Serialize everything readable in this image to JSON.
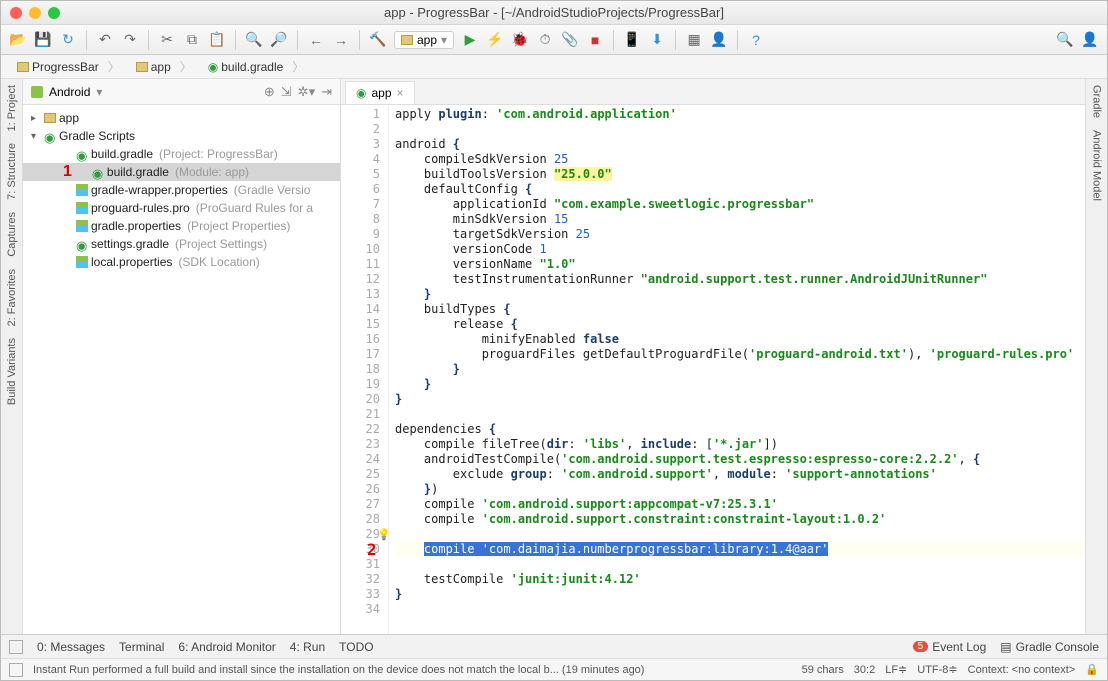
{
  "window": {
    "title": "app - ProgressBar - [~/AndroidStudioProjects/ProgressBar]"
  },
  "run_config": "app",
  "breadcrumb": [
    "ProgressBar",
    "app",
    "build.gradle"
  ],
  "left_tools": [
    "1: Project",
    "7: Structure",
    "Captures",
    "2: Favorites",
    "Build Variants"
  ],
  "right_tools": [
    "Gradle",
    "Android Model"
  ],
  "project_pane": {
    "view": "Android",
    "root": "app",
    "scripts_label": "Gradle Scripts",
    "items": [
      {
        "name": "build.gradle",
        "hint": "(Project: ProgressBar)",
        "icon": "gradle"
      },
      {
        "name": "build.gradle",
        "hint": "(Module: app)",
        "icon": "gradle",
        "selected": true,
        "annot": "1"
      },
      {
        "name": "gradle-wrapper.properties",
        "hint": "(Gradle Versio",
        "icon": "prop"
      },
      {
        "name": "proguard-rules.pro",
        "hint": "(ProGuard Rules for a",
        "icon": "prop"
      },
      {
        "name": "gradle.properties",
        "hint": "(Project Properties)",
        "icon": "prop"
      },
      {
        "name": "settings.gradle",
        "hint": "(Project Settings)",
        "icon": "gradle"
      },
      {
        "name": "local.properties",
        "hint": "(SDK Location)",
        "icon": "prop"
      }
    ]
  },
  "editor_tab": "app",
  "annotation2": "2",
  "code_lines": [
    {
      "n": 1,
      "frags": [
        [
          "p",
          "apply "
        ],
        [
          "kw",
          "plugin"
        ],
        [
          "p",
          ": "
        ],
        [
          "str",
          "'com.android.application'"
        ]
      ]
    },
    {
      "n": 2,
      "frags": []
    },
    {
      "n": 3,
      "frags": [
        [
          "p",
          "android "
        ],
        [
          "kw",
          "{"
        ]
      ]
    },
    {
      "n": 4,
      "frags": [
        [
          "p",
          "    compileSdkVersion "
        ],
        [
          "num",
          "25"
        ]
      ]
    },
    {
      "n": 5,
      "frags": [
        [
          "p",
          "    buildToolsVersion "
        ],
        [
          "str hl-y",
          "\"25.0.0\""
        ]
      ]
    },
    {
      "n": 6,
      "frags": [
        [
          "p",
          "    defaultConfig "
        ],
        [
          "kw",
          "{"
        ]
      ]
    },
    {
      "n": 7,
      "frags": [
        [
          "p",
          "        applicationId "
        ],
        [
          "str",
          "\"com.example.sweetlogic.progressbar\""
        ]
      ]
    },
    {
      "n": 8,
      "frags": [
        [
          "p",
          "        minSdkVersion "
        ],
        [
          "num",
          "15"
        ]
      ]
    },
    {
      "n": 9,
      "frags": [
        [
          "p",
          "        targetSdkVersion "
        ],
        [
          "num",
          "25"
        ]
      ]
    },
    {
      "n": 10,
      "frags": [
        [
          "p",
          "        versionCode "
        ],
        [
          "num",
          "1"
        ]
      ]
    },
    {
      "n": 11,
      "frags": [
        [
          "p",
          "        versionName "
        ],
        [
          "str",
          "\"1.0\""
        ]
      ]
    },
    {
      "n": 12,
      "frags": [
        [
          "p",
          "        testInstrumentationRunner "
        ],
        [
          "str",
          "\"android.support.test.runner.AndroidJUnitRunner\""
        ]
      ]
    },
    {
      "n": 13,
      "frags": [
        [
          "p",
          "    "
        ],
        [
          "kw",
          "}"
        ]
      ]
    },
    {
      "n": 14,
      "frags": [
        [
          "p",
          "    buildTypes "
        ],
        [
          "kw",
          "{"
        ]
      ]
    },
    {
      "n": 15,
      "frags": [
        [
          "p",
          "        release "
        ],
        [
          "kw",
          "{"
        ]
      ]
    },
    {
      "n": 16,
      "frags": [
        [
          "p",
          "            minifyEnabled "
        ],
        [
          "kw",
          "false"
        ]
      ]
    },
    {
      "n": 17,
      "frags": [
        [
          "p",
          "            proguardFiles getDefaultProguardFile("
        ],
        [
          "str",
          "'proguard-android.txt'"
        ],
        [
          "p",
          "), "
        ],
        [
          "str",
          "'proguard-rules.pro'"
        ]
      ]
    },
    {
      "n": 18,
      "frags": [
        [
          "p",
          "        "
        ],
        [
          "kw",
          "}"
        ]
      ]
    },
    {
      "n": 19,
      "frags": [
        [
          "p",
          "    "
        ],
        [
          "kw",
          "}"
        ]
      ]
    },
    {
      "n": 20,
      "frags": [
        [
          "kw",
          "}"
        ]
      ]
    },
    {
      "n": 21,
      "frags": []
    },
    {
      "n": 22,
      "frags": [
        [
          "p",
          "dependencies "
        ],
        [
          "kw",
          "{"
        ]
      ]
    },
    {
      "n": 23,
      "frags": [
        [
          "p",
          "    compile fileTree("
        ],
        [
          "kw",
          "dir"
        ],
        [
          "p",
          ": "
        ],
        [
          "str",
          "'libs'"
        ],
        [
          "p",
          ", "
        ],
        [
          "kw",
          "include"
        ],
        [
          "p",
          ": ["
        ],
        [
          "str",
          "'*.jar'"
        ],
        [
          "p",
          "])"
        ]
      ]
    },
    {
      "n": 24,
      "frags": [
        [
          "p",
          "    androidTestCompile("
        ],
        [
          "str",
          "'com.android.support.test.espresso:espresso-core:2.2.2'"
        ],
        [
          "p",
          ", "
        ],
        [
          "kw",
          "{"
        ]
      ]
    },
    {
      "n": 25,
      "frags": [
        [
          "p",
          "        exclude "
        ],
        [
          "kw",
          "group"
        ],
        [
          "p",
          ": "
        ],
        [
          "str",
          "'com.android.support'"
        ],
        [
          "p",
          ", "
        ],
        [
          "kw",
          "module"
        ],
        [
          "p",
          ": "
        ],
        [
          "str",
          "'support-annotations'"
        ]
      ]
    },
    {
      "n": 26,
      "frags": [
        [
          "p",
          "    "
        ],
        [
          "kw",
          "}"
        ],
        [
          "p",
          ")"
        ]
      ]
    },
    {
      "n": 27,
      "frags": [
        [
          "p",
          "    compile "
        ],
        [
          "str",
          "'com.android.support:appcompat-v7:25.3.1'"
        ]
      ]
    },
    {
      "n": 28,
      "frags": [
        [
          "p",
          "    compile "
        ],
        [
          "str",
          "'com.android.support.constraint:constraint-layout:1.0.2'"
        ]
      ]
    },
    {
      "n": 29,
      "frags": [],
      "bulb": true
    },
    {
      "n": 30,
      "hlLine": true,
      "annot": "2",
      "frags": [
        [
          "p",
          "    "
        ],
        [
          "sel",
          "compile 'com.daimajia.numberprogressbar:library:1.4@aar'"
        ]
      ]
    },
    {
      "n": 31,
      "frags": []
    },
    {
      "n": 32,
      "frags": [
        [
          "p",
          "    testCompile "
        ],
        [
          "str",
          "'junit:junit:4.12'"
        ]
      ]
    },
    {
      "n": 33,
      "frags": [
        [
          "kw",
          "}"
        ]
      ]
    },
    {
      "n": 34,
      "frags": []
    }
  ],
  "bottom_bar": {
    "items": [
      "0: Messages",
      "Terminal",
      "6: Android Monitor",
      "4: Run",
      "TODO"
    ],
    "event_log": "Event Log",
    "event_badge": "5",
    "gradle_console": "Gradle Console"
  },
  "status": {
    "msg": "Instant Run performed a full build and install since the installation on the device does not match the local b... (19 minutes ago)",
    "chars": "59 chars",
    "pos": "30:2",
    "le": "LF≑",
    "enc": "UTF-8≑",
    "context": "Context: <no context>"
  }
}
